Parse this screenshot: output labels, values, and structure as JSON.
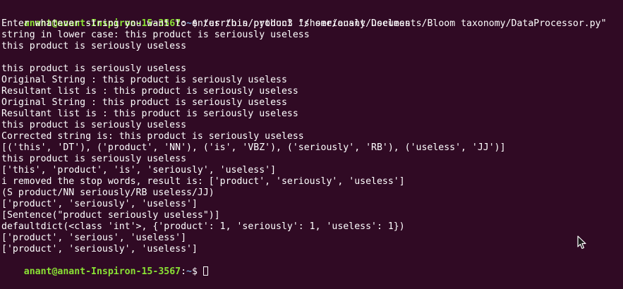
{
  "prompt": {
    "user_host": "anant@anant-Inspiron-15-3567",
    "separator": ":",
    "cwd": "~",
    "symbol": "$ "
  },
  "command": "/usr/bin/python3 \"/home/anant/Documents/Bloom taxonomy/DataProcessor.py\"",
  "output_lines": [
    "Enter whatever string you want to enter this product is seriously useless",
    "string in lower case: this product is seriously useless",
    "this product is seriously useless",
    "",
    "this product is seriously useless",
    "Original String : this product is seriously useless",
    "Resultant list is : this product is seriously useless",
    "Original String : this product is seriously useless",
    "Resultant list is : this product is seriously useless",
    "this product is seriously useless",
    "Corrected string is: this product is seriously useless",
    "[('this', 'DT'), ('product', 'NN'), ('is', 'VBZ'), ('seriously', 'RB'), ('useless', 'JJ')]",
    "this product is seriously useless",
    "['this', 'product', 'is', 'seriously', 'useless']",
    "i removed the stop words, result is: ['product', 'seriously', 'useless']",
    "(S product/NN seriously/RB useless/JJ)",
    "['product', 'seriously', 'useless']",
    "[Sentence(\"product seriously useless\")]",
    "defaultdict(<class 'int'>, {'product': 1, 'seriously': 1, 'useless': 1})",
    "['product', 'serious', 'useless']",
    "['product', 'seriously', 'useless']"
  ],
  "colors": {
    "background": "#300a24",
    "user_host": "#8ae234",
    "cwd": "#729fcf",
    "text": "#ffffff"
  },
  "icons": {
    "cursor": "block-cursor-icon",
    "mouse": "mouse-pointer-icon"
  }
}
